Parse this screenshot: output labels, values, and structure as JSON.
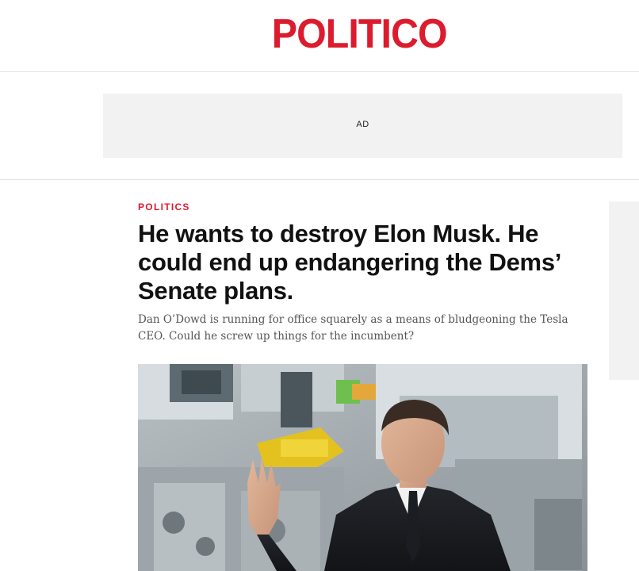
{
  "brand": {
    "name": "POLITICO",
    "color": "#dc1c2e"
  },
  "ad": {
    "label": "AD"
  },
  "article": {
    "kicker": "POLITICS",
    "headline": "He wants to destroy Elon Musk. He could end up endangering the Dems’ Senate plans.",
    "dek": "Dan O’Dowd is running for office squarely as a means of bludgeoning the Tesla CEO. Could he screw up things for the incumbent?"
  },
  "image": {
    "subject": "man-in-suit-waving-in-factory"
  }
}
